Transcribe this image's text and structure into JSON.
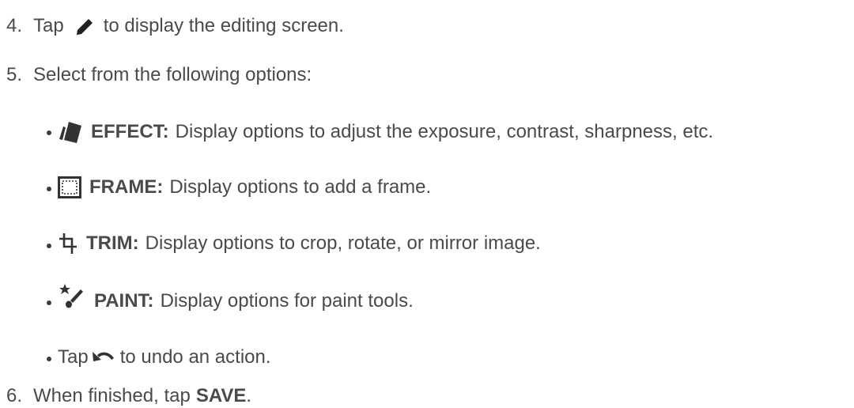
{
  "steps": [
    {
      "number": "4.",
      "text_before": "Tap",
      "icon": "pencil-icon",
      "text_after": "to display the editing screen."
    },
    {
      "number": "5.",
      "text": "Select from the following options:"
    },
    {
      "number": "6.",
      "text_before": "When finished, tap",
      "bold": "SAVE",
      "text_after": "."
    }
  ],
  "options": [
    {
      "icon": "effect-icon",
      "label": "EFFECT:",
      "description": "Display options to adjust the exposure, contrast, sharpness, etc."
    },
    {
      "icon": "frame-icon",
      "label": "FRAME:",
      "description": "Display options to add a frame."
    },
    {
      "icon": "crop-icon",
      "label": "TRIM:",
      "description": "Display options to crop, rotate, or mirror image."
    },
    {
      "icon": "paint-icon",
      "label": "PAINT:",
      "description": "Display options for paint tools."
    }
  ],
  "undo": {
    "text_before": "Tap",
    "icon": "undo-icon",
    "text_after": "to undo an action."
  }
}
